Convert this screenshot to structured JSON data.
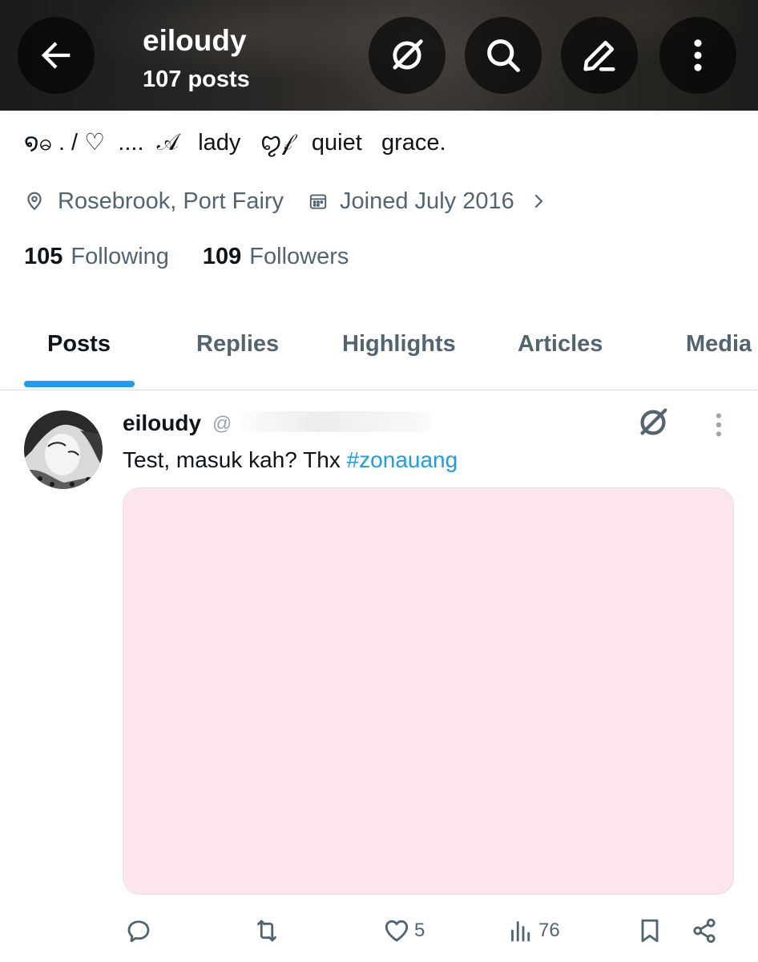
{
  "header": {
    "title": "eiloudy",
    "subtitle": "107 posts"
  },
  "profile": {
    "bio": "໑ဓ . / ♡  ....  𝒜   lady   ꨄ𝒻   quiet   grace.",
    "location": "Rosebrook, Port Fairy",
    "joined": "Joined July 2016",
    "following_count": "105",
    "following_label": "Following",
    "followers_count": "109",
    "followers_label": "Followers"
  },
  "tabs": [
    {
      "label": "Posts",
      "active": true
    },
    {
      "label": "Replies",
      "active": false
    },
    {
      "label": "Highlights",
      "active": false
    },
    {
      "label": "Articles",
      "active": false
    },
    {
      "label": "Media",
      "active": false
    }
  ],
  "post": {
    "author": "eiloudy",
    "handle": "@",
    "text": "Test, masuk kah? Thx ",
    "hashtag": "#zonauang",
    "media_color": "#fce6ec",
    "likes": "5",
    "views": "76"
  },
  "colors": {
    "accent": "#1d9bf0",
    "secondary_text": "#536471"
  },
  "icons": [
    "back-arrow-icon",
    "grok-icon",
    "search-icon",
    "edit-icon",
    "more-icon",
    "location-icon",
    "calendar-icon",
    "chevron-right-icon",
    "reply-icon",
    "repost-icon",
    "heart-icon",
    "views-icon",
    "bookmark-icon",
    "share-icon"
  ]
}
